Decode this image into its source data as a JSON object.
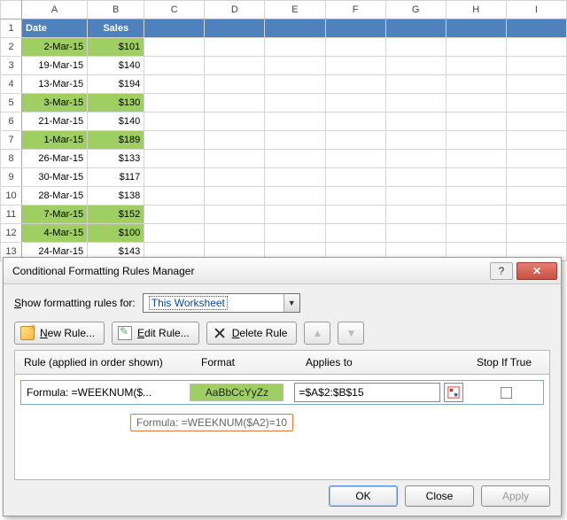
{
  "sheet": {
    "columns": [
      "A",
      "B",
      "C",
      "D",
      "E",
      "F",
      "G",
      "H",
      "I"
    ],
    "row_count": 13,
    "headers": {
      "date": "Date",
      "sales": "Sales"
    },
    "rows": [
      {
        "date": "2-Mar-15",
        "sales": "$101",
        "highlight": true
      },
      {
        "date": "19-Mar-15",
        "sales": "$140",
        "highlight": false
      },
      {
        "date": "13-Mar-15",
        "sales": "$194",
        "highlight": false
      },
      {
        "date": "3-Mar-15",
        "sales": "$130",
        "highlight": true
      },
      {
        "date": "21-Mar-15",
        "sales": "$140",
        "highlight": false
      },
      {
        "date": "1-Mar-15",
        "sales": "$189",
        "highlight": true
      },
      {
        "date": "26-Mar-15",
        "sales": "$133",
        "highlight": false
      },
      {
        "date": "30-Mar-15",
        "sales": "$117",
        "highlight": false
      },
      {
        "date": "28-Mar-15",
        "sales": "$138",
        "highlight": false
      },
      {
        "date": "7-Mar-15",
        "sales": "$152",
        "highlight": true
      },
      {
        "date": "4-Mar-15",
        "sales": "$100",
        "highlight": true
      },
      {
        "date": "24-Mar-15",
        "sales": "$143",
        "highlight": false
      }
    ]
  },
  "dialog": {
    "title": "Conditional Formatting Rules Manager",
    "show_label_prefix": "S",
    "show_label_rest": "how formatting rules for:",
    "scope_selected": "This Worksheet",
    "buttons": {
      "new_prefix": "N",
      "new_rest": "ew Rule...",
      "edit_prefix": "E",
      "edit_rest": "dit Rule...",
      "delete_prefix": "D",
      "delete_rest": "elete Rule",
      "ok": "OK",
      "close": "Close",
      "apply": "Apply"
    },
    "list_headers": {
      "rule": "Rule (applied in order shown)",
      "format": "Format",
      "applies": "Applies to",
      "stop": "Stop If True"
    },
    "rule": {
      "label": "Formula: =WEEKNUM($...",
      "full": "Formula: =WEEKNUM($A2)=10",
      "preview": "AaBbCcYyZz",
      "applies_to": "=$A$2:$B$15"
    }
  }
}
